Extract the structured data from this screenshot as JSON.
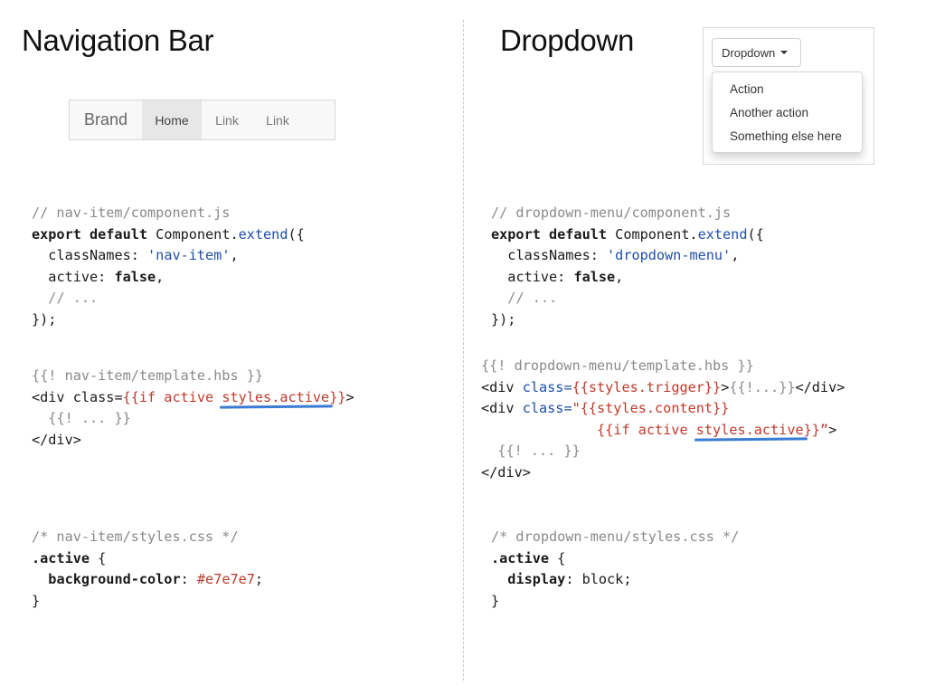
{
  "titles": {
    "navbar": "Navigation Bar",
    "dropdown": "Dropdown"
  },
  "navbar_demo": {
    "brand": "Brand",
    "items": [
      "Home",
      "Link",
      "Link"
    ],
    "active_index": 0
  },
  "dropdown_demo": {
    "button_label": "Dropdown",
    "items": [
      "Action",
      "Another action",
      "Something else here"
    ]
  },
  "code": {
    "nav_js": {
      "comment": "// nav-item/component.js",
      "export_kw": "export default",
      "component": "Component.",
      "extend": "extend",
      "open": "({",
      "classnames_key": "classNames: ",
      "classnames_val": "'nav-item'",
      "comma": ",",
      "active_key": "active: ",
      "active_val": "false",
      "ellipsis": "// ...",
      "close": "});"
    },
    "nav_hbs": {
      "comment": "{{! nav-item/template.hbs }}",
      "div_open": "<div",
      "class_attr": " class=",
      "expr_pre": "{{if active ",
      "expr_hl": "styles.active",
      "expr_post": "}}",
      "gt": ">",
      "inner": "{{! ... }}",
      "div_close": "</div>"
    },
    "nav_css": {
      "comment": "/* nav-item/styles.css */",
      "selector": ".active",
      "brace_open": " {",
      "prop": "background-color",
      "colon": ": ",
      "value": "#e7e7e7",
      "semi": ";",
      "brace_close": "}"
    },
    "dd_js": {
      "comment": "// dropdown-menu/component.js",
      "export_kw": "export default",
      "component": "Component.",
      "extend": "extend",
      "open": "({",
      "classnames_key": "classNames: ",
      "classnames_val": "'dropdown-menu'",
      "comma": ",",
      "active_key": "active: ",
      "active_val": "false",
      "ellipsis": "// ...",
      "close": "});"
    },
    "dd_hbs": {
      "comment": "{{! dropdown-menu/template.hbs }}",
      "div_open": "<div",
      "class_attr": " class=",
      "trigger_expr": "{{styles.trigger}}",
      "gt": ">",
      "inner_comment": "{{!...}}",
      "div_close": "</div>",
      "content_open": "\"{{styles.content}}",
      "expr_pre": "{{if active ",
      "expr_hl": "styles.active",
      "expr_post": "}}”",
      "inner": "{{! ... }}"
    },
    "dd_css": {
      "comment": "/* dropdown-menu/styles.css */",
      "selector": ".active",
      "brace_open": " {",
      "prop": "display",
      "colon": ": ",
      "value": "block",
      "semi": ";",
      "brace_close": "}"
    }
  }
}
